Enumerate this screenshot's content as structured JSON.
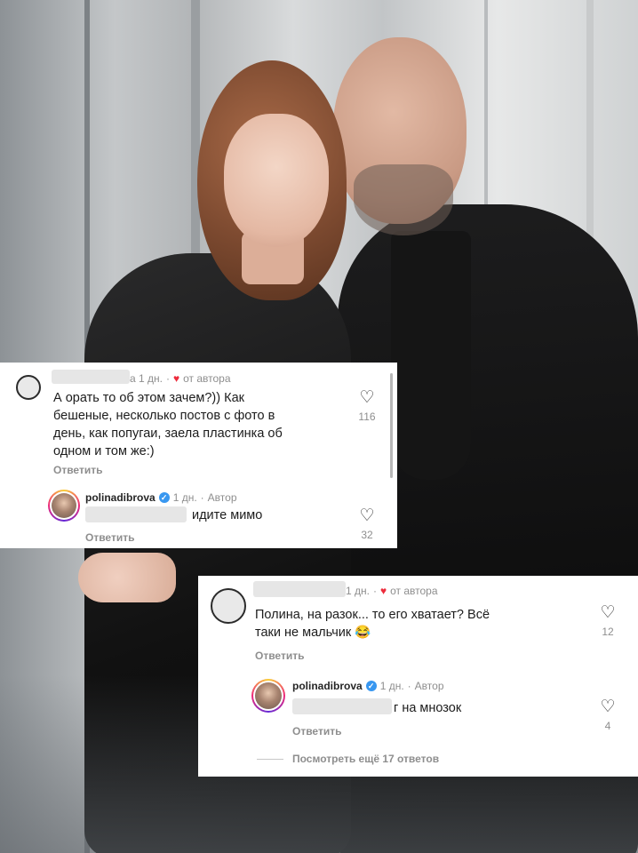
{
  "card1": {
    "comment": {
      "time": "а 1 дн.",
      "from_author": "от автора",
      "text_lines": [
        "А орать то об этом зачем?)) Как",
        "бешеные, несколько постов с фото в",
        "день, как попугаи, заела пластинка об",
        "одном и том же:)"
      ],
      "reply_label": "Ответить",
      "likes": "116"
    },
    "reply": {
      "username": "polinadibrova",
      "time": "1 дн.",
      "author": "Автор",
      "text": "идите мимо",
      "reply_label": "Ответить",
      "likes": "32"
    }
  },
  "card2": {
    "comment": {
      "time": "1 дн.",
      "from_author": "от автора",
      "text_lines": [
        "Полина, на разок... то его хватает? Всё",
        "таки не мальчик 😂"
      ],
      "reply_label": "Ответить",
      "likes": "12"
    },
    "reply": {
      "username": "polinadibrova",
      "time": "1 дн.",
      "author": "Автор",
      "text": "г на мнозок",
      "reply_label": "Ответить",
      "likes": "4"
    },
    "view_more": "Посмотреть ещё 17 ответов"
  },
  "icons": {
    "heart_outline": "♡",
    "heart_filled": "♥",
    "verified": "✓",
    "separator": "·"
  },
  "colors": {
    "author_heart": "#ed2c3c",
    "verified": "#3897f0",
    "secondary_text": "#8e8e8e"
  }
}
